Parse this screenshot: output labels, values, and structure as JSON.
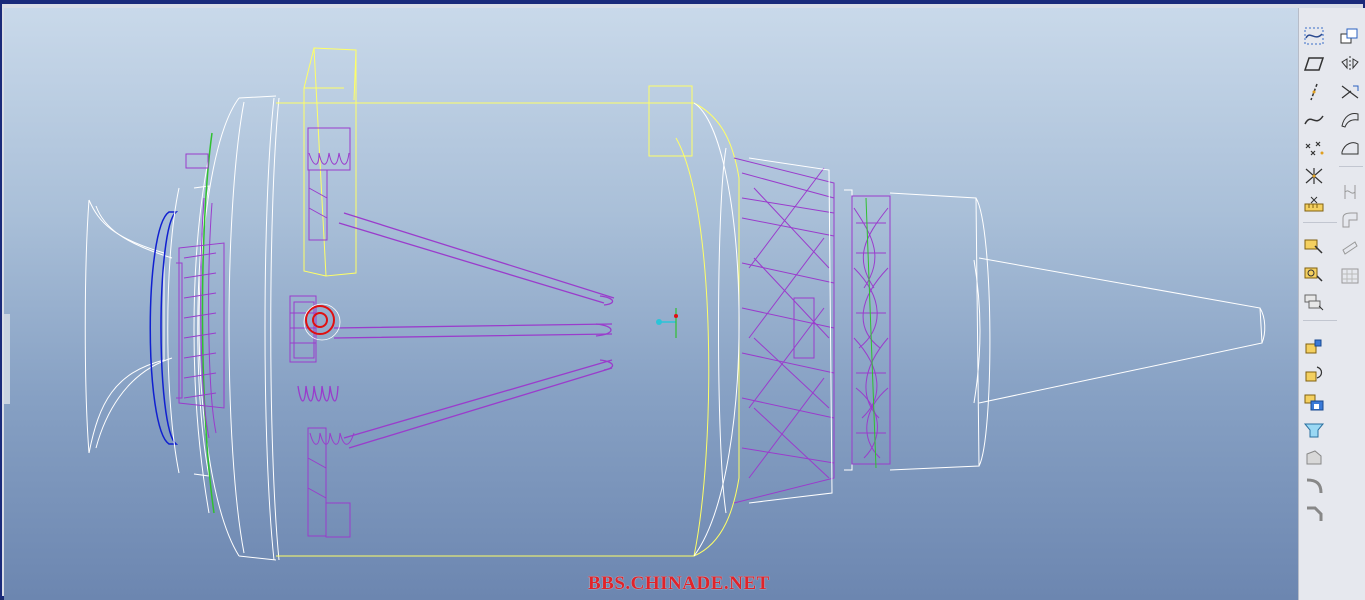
{
  "viewport": {
    "watermark": "BBS.CHINADE.NET",
    "colors": {
      "background_top": "#c9d9ea",
      "background_bottom": "#6c86b0",
      "edge_white": "#ffffff",
      "edge_yellow": "#ffff66",
      "edge_purple": "#9a3ccc",
      "edge_blue": "#1020d0",
      "edge_green": "#30c030",
      "edge_red": "#e01010"
    }
  },
  "toolbar": {
    "left_column": [
      {
        "icon": "datum-plane-icon"
      },
      {
        "icon": "plane-parallelogram-icon"
      },
      {
        "icon": "datum-axis-icon"
      },
      {
        "icon": "datum-curve-icon"
      },
      {
        "icon": "datum-point-icon"
      },
      {
        "icon": "coordinate-system-icon"
      },
      {
        "icon": "analysis-measure-icon"
      },
      {
        "icon": "sketch-icon"
      },
      {
        "icon": "sketch-settings-icon"
      },
      {
        "icon": "layer-icon"
      },
      {
        "icon": "extrude-icon"
      },
      {
        "icon": "revolve-icon"
      },
      {
        "icon": "sweep-icon"
      },
      {
        "icon": "blend-icon"
      },
      {
        "icon": "hole-icon"
      },
      {
        "icon": "round-icon"
      },
      {
        "icon": "chamfer-icon"
      },
      {
        "icon": "shell-icon"
      }
    ],
    "right_column": [
      {
        "icon": "copy-icon"
      },
      {
        "icon": "mirror-icon"
      },
      {
        "icon": "merge-icon"
      },
      {
        "icon": "surface-icon"
      },
      {
        "icon": "boundary-blend-icon"
      },
      {
        "icon": "trim-icon"
      },
      {
        "icon": "offset-icon"
      },
      {
        "icon": "thicken-icon"
      },
      {
        "icon": "pattern-icon"
      }
    ]
  }
}
